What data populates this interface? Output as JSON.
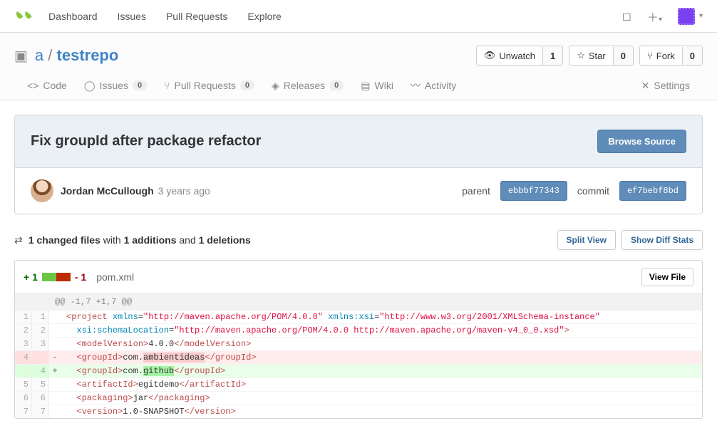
{
  "topnav": {
    "links": [
      "Dashboard",
      "Issues",
      "Pull Requests",
      "Explore"
    ]
  },
  "repo": {
    "owner": "a",
    "name": "testrepo",
    "actions": {
      "unwatch_label": "Unwatch",
      "unwatch_count": "1",
      "star_label": "Star",
      "star_count": "0",
      "fork_label": "Fork",
      "fork_count": "0"
    },
    "tabs": {
      "code": "Code",
      "issues": "Issues",
      "issues_count": "0",
      "pulls": "Pull Requests",
      "pulls_count": "0",
      "releases": "Releases",
      "releases_count": "0",
      "wiki": "Wiki",
      "activity": "Activity",
      "settings": "Settings"
    }
  },
  "commit": {
    "title": "Fix groupId after package refactor",
    "browse_label": "Browse Source",
    "author": "Jordan McCullough",
    "time": "3 years ago",
    "parent_label": "parent",
    "parent_sha": "ebbbf77343",
    "commit_label": "commit",
    "commit_sha": "ef7bebf8bd"
  },
  "diffbar": {
    "files": "1 changed files",
    "with": " with ",
    "adds": "1 additions",
    "and": " and ",
    "dels": "1 deletions",
    "split": "Split View",
    "show": "Show Diff Stats"
  },
  "file": {
    "add": "+ 1",
    "del": "- 1",
    "name": "pom.xml",
    "viewfile": "View File",
    "hunk": "@@ -1,7 +1,7 @@"
  },
  "lines": [
    {
      "ol": "1",
      "nl": "1",
      "sign": " ",
      "type": "ctx",
      "html": "<span class='tag'>&lt;project</span> <span class='attr'>xmlns</span>=<span class='str'>\"http://maven.apache.org/POM/4.0.0\"</span> <span class='attr'>xmlns:xsi</span>=<span class='str'>\"http://www.w3.org/2001/XMLSchema-instance\"</span>"
    },
    {
      "ol": "2",
      "nl": "2",
      "sign": " ",
      "type": "ctx",
      "html": "  <span class='attr'>xsi:schemaLocation</span>=<span class='str'>\"http://maven.apache.org/POM/4.0.0 http://maven.apache.org/maven-v4_0_0.xsd\"</span><span class='tag'>&gt;</span>"
    },
    {
      "ol": "3",
      "nl": "3",
      "sign": " ",
      "type": "ctx",
      "html": "  <span class='tag'>&lt;modelVersion&gt;</span><span class='txt'>4.0.0</span><span class='tag'>&lt;/modelVersion&gt;</span>"
    },
    {
      "ol": "4",
      "nl": "",
      "sign": "-",
      "type": "del",
      "html": "  <span class='tag'>&lt;groupId&gt;</span><span class='txt'>com.</span><span class='hl-del'>ambientideas</span><span class='tag'>&lt;/groupId&gt;</span>"
    },
    {
      "ol": "",
      "nl": "4",
      "sign": "+",
      "type": "add",
      "html": "  <span class='tag'>&lt;groupId&gt;</span><span class='txt'>com.</span><span class='hl-add'>github</span><span class='tag'>&lt;/groupId&gt;</span>"
    },
    {
      "ol": "5",
      "nl": "5",
      "sign": " ",
      "type": "ctx",
      "html": "  <span class='tag'>&lt;artifactId&gt;</span><span class='txt'>egitdemo</span><span class='tag'>&lt;/artifactId&gt;</span>"
    },
    {
      "ol": "6",
      "nl": "6",
      "sign": " ",
      "type": "ctx",
      "html": "  <span class='tag'>&lt;packaging&gt;</span><span class='txt'>jar</span><span class='tag'>&lt;/packaging&gt;</span>"
    },
    {
      "ol": "7",
      "nl": "7",
      "sign": " ",
      "type": "ctx",
      "html": "  <span class='tag'>&lt;version&gt;</span><span class='txt'>1.0-SNAPSHOT</span><span class='tag'>&lt;/version&gt;</span>"
    }
  ]
}
